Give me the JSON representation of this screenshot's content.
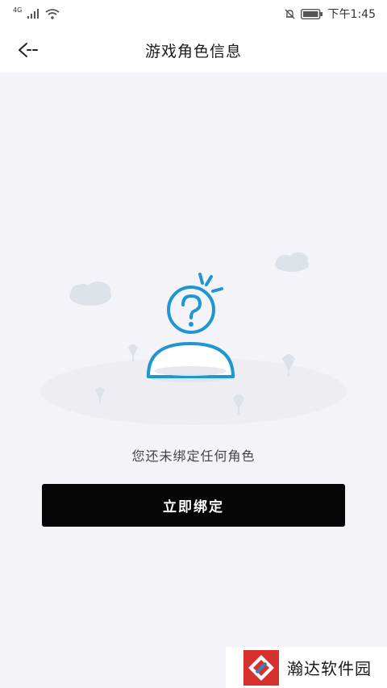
{
  "status_bar": {
    "network": "4G",
    "time": "下午1:45"
  },
  "header": {
    "title": "游戏角色信息",
    "back_icon": "back-arrow-icon"
  },
  "empty_state": {
    "illustration": "unknown-user-question-icon",
    "message": "您还未绑定任何角色"
  },
  "actions": {
    "bind_label": "立即绑定"
  },
  "watermark": {
    "text": "瀚达软件园"
  },
  "colors": {
    "accent": "#1e96d4",
    "button_bg": "#050505",
    "page_bg": "#f4f4f8"
  }
}
